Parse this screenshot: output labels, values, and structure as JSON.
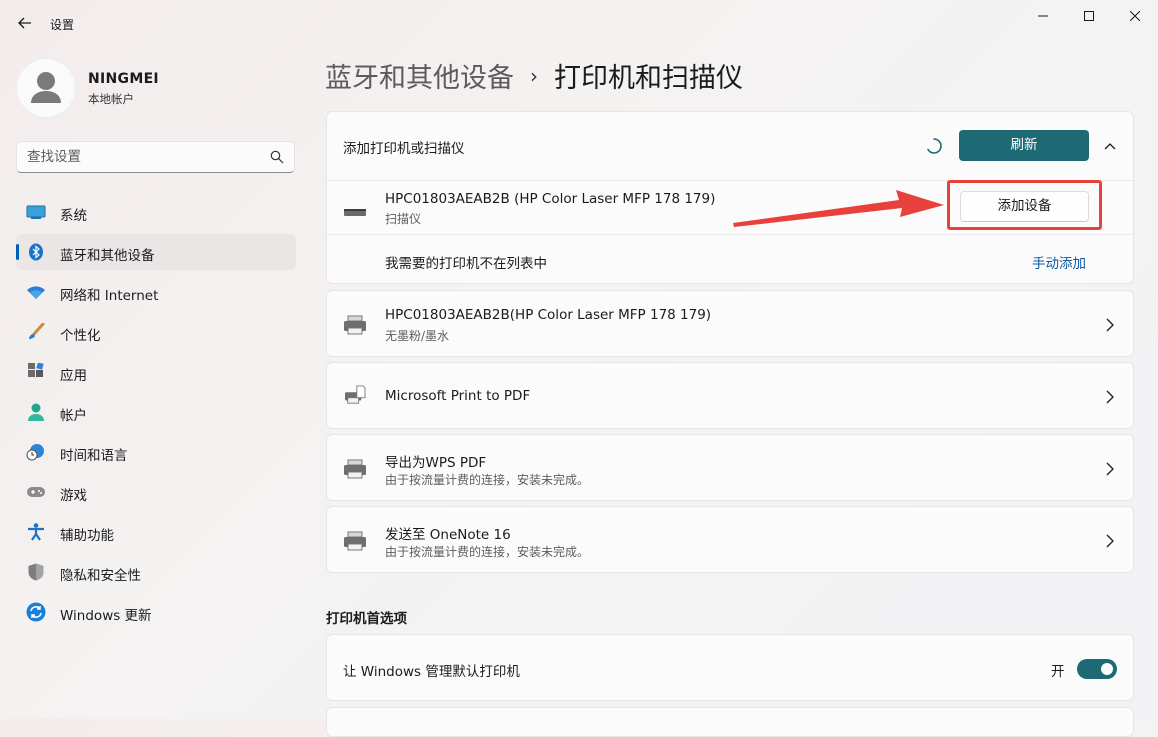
{
  "window": {
    "title": "设置"
  },
  "user": {
    "name": "NINGMEI",
    "account_type": "本地帐户"
  },
  "search": {
    "placeholder": "查找设置"
  },
  "nav": {
    "items": [
      {
        "label": "系统",
        "icon": "system-icon"
      },
      {
        "label": "蓝牙和其他设备",
        "icon": "bluetooth-icon",
        "active": true
      },
      {
        "label": "网络和 Internet",
        "icon": "wifi-icon"
      },
      {
        "label": "个性化",
        "icon": "brush-icon"
      },
      {
        "label": "应用",
        "icon": "apps-icon"
      },
      {
        "label": "帐户",
        "icon": "person-icon"
      },
      {
        "label": "时间和语言",
        "icon": "globe-clock-icon"
      },
      {
        "label": "游戏",
        "icon": "gamepad-icon"
      },
      {
        "label": "辅助功能",
        "icon": "accessibility-icon"
      },
      {
        "label": "隐私和安全性",
        "icon": "shield-icon"
      },
      {
        "label": "Windows 更新",
        "icon": "update-icon"
      }
    ]
  },
  "header": {
    "parent": "蓝牙和其他设备",
    "separator": "›",
    "current": "打印机和扫描仪"
  },
  "add_panel": {
    "title": "添加打印机或扫描仪",
    "refresh_label": "刷新",
    "found_device": {
      "name": "HPC01803AEAB2B (HP Color Laser MFP 178 179)",
      "type": "扫描仪",
      "add_label": "添加设备"
    },
    "manual": {
      "text": "我需要的打印机不在列表中",
      "link": "手动添加"
    }
  },
  "printers": [
    {
      "name": "HPC01803AEAB2B(HP Color Laser MFP 178 179)",
      "status": "无墨粉/墨水"
    },
    {
      "name": "Microsoft Print to PDF",
      "status": ""
    },
    {
      "name": "导出为WPS PDF",
      "status": "由于按流量计费的连接，安装未完成。"
    },
    {
      "name": "发送至 OneNote 16",
      "status": "由于按流量计费的连接，安装未完成。"
    }
  ],
  "preferences": {
    "title": "打印机首选项",
    "default_manage": {
      "label": "让 Windows 管理默认打印机",
      "state_label": "开",
      "on": true
    }
  },
  "colors": {
    "accent": "#1e6a74",
    "link": "#0f5aa3",
    "annotation": "#e8413c"
  }
}
